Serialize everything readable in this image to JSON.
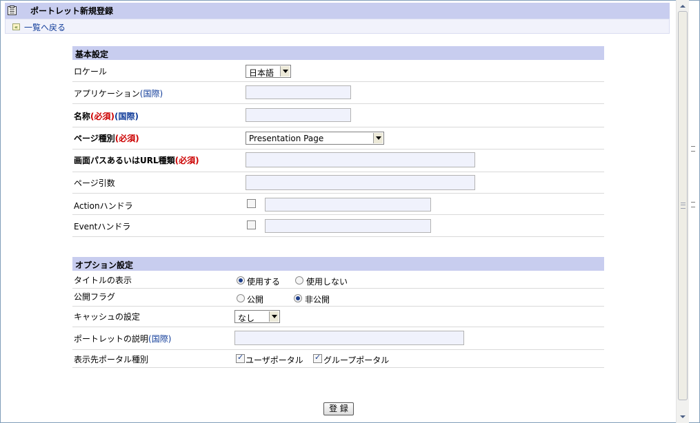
{
  "header": {
    "title": "ポートレット新規登録",
    "back_link": "一覧へ戻る",
    "back_icon": "«"
  },
  "basic": {
    "section_title": "基本設定",
    "locale": {
      "label": "ロケール",
      "value": "日本語"
    },
    "application": {
      "label": "アプリケーション",
      "intl": "(国際)",
      "value": ""
    },
    "name": {
      "label": "名称",
      "required": "(必須)",
      "intl": "(国際)",
      "value": ""
    },
    "page_type": {
      "label": "ページ種別",
      "required": "(必須)",
      "value": "Presentation Page"
    },
    "screen_path": {
      "label": "画面パスあるいはURL種類",
      "required": "(必須)",
      "value": ""
    },
    "page_args": {
      "label": "ページ引数",
      "value": ""
    },
    "action_handler": {
      "label": "Actionハンドラ",
      "value": ""
    },
    "event_handler": {
      "label": "Eventハンドラ",
      "value": ""
    }
  },
  "options": {
    "section_title": "オプション設定",
    "title_display": {
      "label": "タイトルの表示",
      "opt_use": "使用する",
      "opt_nouse": "使用しない"
    },
    "public_flag": {
      "label": "公開フラグ",
      "opt_public": "公開",
      "opt_private": "非公開"
    },
    "cache": {
      "label": "キャッシュの設定",
      "value": "なし"
    },
    "description": {
      "label": "ポートレットの説明",
      "intl": "(国際)",
      "value": ""
    },
    "portal_type": {
      "label": "表示先ポータル種別",
      "opt_user": "ユーザポータル",
      "opt_group": "グループポータル"
    }
  },
  "submit_label": "登 録"
}
